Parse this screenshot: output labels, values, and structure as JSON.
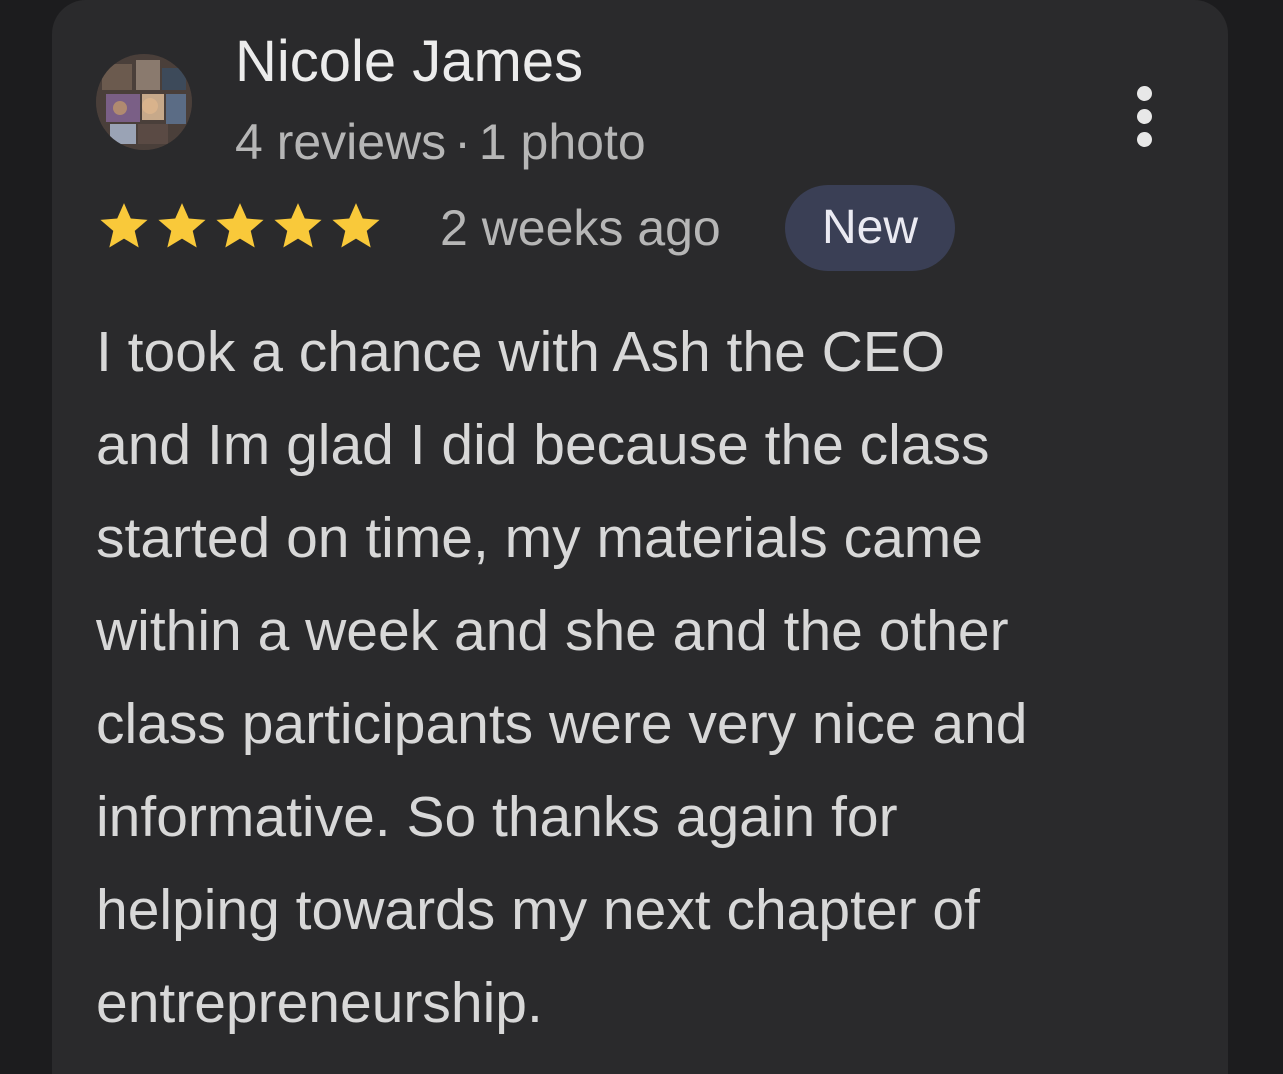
{
  "review": {
    "reviewer_name": "Nicole James",
    "reviews_count": "4 reviews",
    "meta_separator": "·",
    "photos_count": "1 photo",
    "rating": 5,
    "rating_max": 5,
    "star_color": "#f9c93a",
    "time_ago": "2 weeks ago",
    "badge": "New",
    "text_lines": [
      "I took a chance with Ash the CEO",
      "and Im glad I did because the class",
      "started on time, my materials came",
      "within a week and she and the other",
      "class participants were very nice and",
      "informative. So thanks again for",
      "helping towards my next chapter of",
      "entrepreneurship."
    ]
  },
  "icons": {
    "avatar": "avatar-photo",
    "more": "more-vert-icon",
    "star": "star-icon"
  }
}
